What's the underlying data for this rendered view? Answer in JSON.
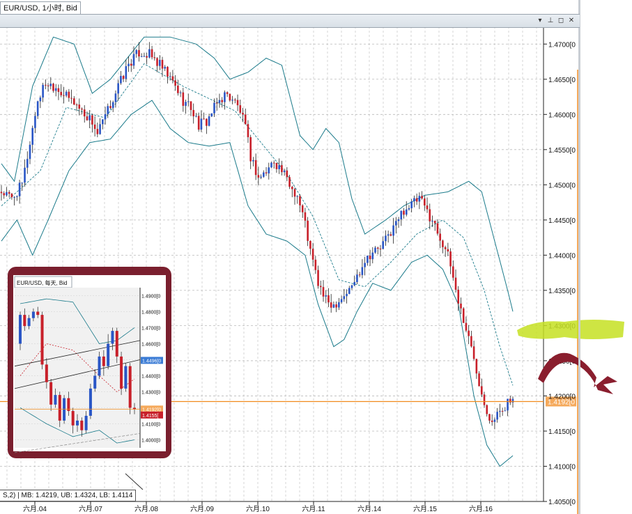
{
  "window": {
    "tab_title": "EUR/USD, 1小时, Bid",
    "buttons": {
      "menu": "▾",
      "pin": "⊥",
      "restore": "◻",
      "close": "✕"
    }
  },
  "chart_data": [
    {
      "type": "candlestick",
      "title": "EUR/USD, 1小时, Bid",
      "indicator": "Bollinger Bands",
      "y_axis": {
        "side": "right",
        "range": [
          1.405,
          1.4725
        ],
        "tick_labels": [
          "1.4700[0",
          "1.4650[0",
          "1.4600[0",
          "1.4550[0",
          "1.4500[0",
          "1.4450[0",
          "1.4400[0",
          "1.4350[0",
          "1.4300[0",
          "1.4250[0",
          "1.4200[0",
          "1.4150[0",
          "1.4100[0",
          "1.4050[0"
        ],
        "ticks": [
          1.47,
          1.465,
          1.46,
          1.455,
          1.45,
          1.445,
          1.44,
          1.435,
          1.43,
          1.425,
          1.42,
          1.415,
          1.41,
          1.405
        ]
      },
      "x_axis": {
        "categories": [
          "六月.04",
          "六月.07",
          "六月.08",
          "六月.09",
          "六月.10",
          "六月.11",
          "六月.14",
          "六月.15",
          "六月.16"
        ]
      },
      "grid": true,
      "current_price": {
        "value": 1.4192,
        "label": "1.4192[0"
      },
      "highlight_label": "1.4300[0",
      "legend_text": "S,2) | MB: 1.4219, UB: 1.4324, LB: 1.4114",
      "path": [
        [
          0,
          1.449
        ],
        [
          4,
          1.448
        ],
        [
          8,
          1.45
        ],
        [
          10,
          1.454
        ],
        [
          14,
          1.462
        ],
        [
          17,
          1.4645
        ],
        [
          21,
          1.464
        ],
        [
          25,
          1.4625
        ],
        [
          28,
          1.4618
        ],
        [
          31,
          1.4605
        ],
        [
          35,
          1.459
        ],
        [
          37,
          1.4572
        ],
        [
          41,
          1.4605
        ],
        [
          45,
          1.464
        ],
        [
          49,
          1.4672
        ],
        [
          53,
          1.4688
        ],
        [
          57,
          1.4685
        ],
        [
          61,
          1.467
        ],
        [
          64,
          1.4655
        ],
        [
          67,
          1.464
        ],
        [
          70,
          1.462
        ],
        [
          73,
          1.461
        ],
        [
          76,
          1.4585
        ],
        [
          79,
          1.459
        ],
        [
          83,
          1.4615
        ],
        [
          86,
          1.4628
        ],
        [
          89,
          1.4623
        ],
        [
          92,
          1.4605
        ],
        [
          94,
          1.458
        ],
        [
          96,
          1.454
        ],
        [
          99,
          1.451
        ],
        [
          102,
          1.4518
        ],
        [
          105,
          1.4535
        ],
        [
          108,
          1.452
        ],
        [
          111,
          1.45
        ],
        [
          114,
          1.4485
        ],
        [
          117,
          1.4445
        ],
        [
          119,
          1.4405
        ],
        [
          122,
          1.436
        ],
        [
          125,
          1.4335
        ],
        [
          128,
          1.433
        ],
        [
          131,
          1.434
        ],
        [
          134,
          1.435
        ],
        [
          137,
          1.437
        ],
        [
          140,
          1.4395
        ],
        [
          143,
          1.4405
        ],
        [
          146,
          1.441
        ],
        [
          149,
          1.4428
        ],
        [
          152,
          1.4445
        ],
        [
          155,
          1.4465
        ],
        [
          158,
          1.4472
        ],
        [
          161,
          1.448
        ],
        [
          163,
          1.4468
        ],
        [
          166,
          1.445
        ],
        [
          169,
          1.4425
        ],
        [
          171,
          1.441
        ],
        [
          173,
          1.4385
        ],
        [
          176,
          1.4335
        ],
        [
          179,
          1.4295
        ],
        [
          182,
          1.4255
        ],
        [
          185,
          1.4205
        ],
        [
          188,
          1.417
        ],
        [
          190,
          1.4165
        ],
        [
          192,
          1.418
        ],
        [
          195,
          1.419
        ],
        [
          197,
          1.4192
        ]
      ],
      "bands": {
        "middle": [
          [
            0,
            1.447
          ],
          [
            15,
            1.452
          ],
          [
            25,
            1.461
          ],
          [
            40,
            1.4595
          ],
          [
            55,
            1.4672
          ],
          [
            70,
            1.464
          ],
          [
            90,
            1.4605
          ],
          [
            100,
            1.456
          ],
          [
            110,
            1.4515
          ],
          [
            120,
            1.4455
          ],
          [
            130,
            1.4365
          ],
          [
            140,
            1.4355
          ],
          [
            150,
            1.439
          ],
          [
            160,
            1.443
          ],
          [
            170,
            1.445
          ],
          [
            178,
            1.4425
          ],
          [
            186,
            1.435
          ],
          [
            192,
            1.427
          ],
          [
            197,
            1.4215
          ]
        ],
        "upper": [
          [
            0,
            1.453
          ],
          [
            5,
            1.4505
          ],
          [
            12,
            1.464
          ],
          [
            20,
            1.471
          ],
          [
            28,
            1.47
          ],
          [
            35,
            1.463
          ],
          [
            42,
            1.465
          ],
          [
            55,
            1.471
          ],
          [
            65,
            1.471
          ],
          [
            75,
            1.47
          ],
          [
            82,
            1.468
          ],
          [
            88,
            1.465
          ],
          [
            95,
            1.466
          ],
          [
            102,
            1.468
          ],
          [
            108,
            1.467
          ],
          [
            115,
            1.457
          ],
          [
            120,
            1.455
          ],
          [
            125,
            1.458
          ],
          [
            130,
            1.456
          ],
          [
            135,
            1.448
          ],
          [
            140,
            1.443
          ],
          [
            148,
            1.445
          ],
          [
            155,
            1.447
          ],
          [
            163,
            1.4485
          ],
          [
            172,
            1.449
          ],
          [
            180,
            1.4505
          ],
          [
            185,
            1.449
          ],
          [
            190,
            1.442
          ],
          [
            195,
            1.435
          ],
          [
            197,
            1.432
          ]
        ],
        "lower": [
          [
            0,
            1.442
          ],
          [
            6,
            1.445
          ],
          [
            12,
            1.44
          ],
          [
            18,
            1.445
          ],
          [
            26,
            1.452
          ],
          [
            34,
            1.456
          ],
          [
            42,
            1.4565
          ],
          [
            50,
            1.46
          ],
          [
            58,
            1.462
          ],
          [
            65,
            1.458
          ],
          [
            72,
            1.456
          ],
          [
            80,
            1.4555
          ],
          [
            88,
            1.456
          ],
          [
            95,
            1.447
          ],
          [
            102,
            1.443
          ],
          [
            110,
            1.442
          ],
          [
            117,
            1.44
          ],
          [
            122,
            1.433
          ],
          [
            128,
            1.427
          ],
          [
            132,
            1.428
          ],
          [
            137,
            1.432
          ],
          [
            143,
            1.436
          ],
          [
            150,
            1.435
          ],
          [
            158,
            1.439
          ],
          [
            164,
            1.44
          ],
          [
            170,
            1.438
          ],
          [
            176,
            1.433
          ],
          [
            182,
            1.42
          ],
          [
            187,
            1.413
          ],
          [
            192,
            1.41
          ],
          [
            197,
            1.4115
          ]
        ]
      }
    },
    {
      "type": "candlestick",
      "title": "EUR/USD, 每天, Bid",
      "y_axis": {
        "range": [
          1.395,
          1.495
        ],
        "tick_labels": [
          "1.4900[0",
          "1.4800[0",
          "1.4700[0",
          "1.4600[0",
          "1.4500[0",
          "1.4400[0",
          "1.4300[0",
          "1.4200[0",
          "1.4100[0",
          "1.4000[0"
        ],
        "ticks": [
          1.49,
          1.48,
          1.47,
          1.46,
          1.45,
          1.44,
          1.43,
          1.42,
          1.41,
          1.4
        ]
      },
      "badges": [
        {
          "label": "1.4496[0",
          "value": 1.4496
        },
        {
          "label": "1.4192[0",
          "value": 1.4192
        },
        {
          "label": "1.4155[",
          "value": 1.4155
        }
      ],
      "candles": [
        [
          1.46,
          1.478,
          1.456,
          1.48
        ],
        [
          1.478,
          1.471,
          1.468,
          1.482
        ],
        [
          1.471,
          1.476,
          1.469,
          1.478
        ],
        [
          1.476,
          1.48,
          1.474,
          1.482
        ],
        [
          1.48,
          1.478,
          1.476,
          1.483
        ],
        [
          1.478,
          1.447,
          1.444,
          1.48
        ],
        [
          1.447,
          1.436,
          1.432,
          1.451
        ],
        [
          1.436,
          1.422,
          1.418,
          1.438
        ],
        [
          1.422,
          1.428,
          1.42,
          1.432
        ],
        [
          1.428,
          1.412,
          1.408,
          1.43
        ],
        [
          1.412,
          1.426,
          1.41,
          1.428
        ],
        [
          1.426,
          1.418,
          1.415,
          1.43
        ],
        [
          1.418,
          1.409,
          1.404,
          1.42
        ],
        [
          1.409,
          1.412,
          1.405,
          1.416
        ],
        [
          1.412,
          1.406,
          1.402,
          1.414
        ],
        [
          1.406,
          1.415,
          1.404,
          1.418
        ],
        [
          1.415,
          1.432,
          1.413,
          1.435
        ],
        [
          1.432,
          1.44,
          1.43,
          1.444
        ],
        [
          1.44,
          1.452,
          1.438,
          1.455
        ],
        [
          1.452,
          1.446,
          1.44,
          1.456
        ],
        [
          1.446,
          1.46,
          1.444,
          1.466
        ],
        [
          1.46,
          1.468,
          1.456,
          1.47
        ],
        [
          1.468,
          1.452,
          1.448,
          1.47
        ],
        [
          1.452,
          1.432,
          1.428,
          1.455
        ],
        [
          1.432,
          1.446,
          1.43,
          1.448
        ],
        [
          1.446,
          1.42,
          1.416,
          1.448
        ],
        [
          1.42,
          1.419,
          1.416,
          1.423
        ]
      ],
      "bands": {
        "middle": [
          [
            0,
            1.44
          ],
          [
            6,
            1.46
          ],
          [
            12,
            1.456
          ],
          [
            18,
            1.44
          ],
          [
            22,
            1.43
          ],
          [
            26,
            1.438
          ]
        ],
        "upper": [
          [
            0,
            1.485
          ],
          [
            6,
            1.488
          ],
          [
            12,
            1.486
          ],
          [
            18,
            1.46
          ],
          [
            22,
            1.462
          ],
          [
            26,
            1.47
          ]
        ],
        "lower": [
          [
            0,
            1.42
          ],
          [
            6,
            1.41
          ],
          [
            12,
            1.402
          ],
          [
            18,
            1.406
          ],
          [
            22,
            1.398
          ],
          [
            26,
            1.4
          ]
        ]
      }
    }
  ]
}
